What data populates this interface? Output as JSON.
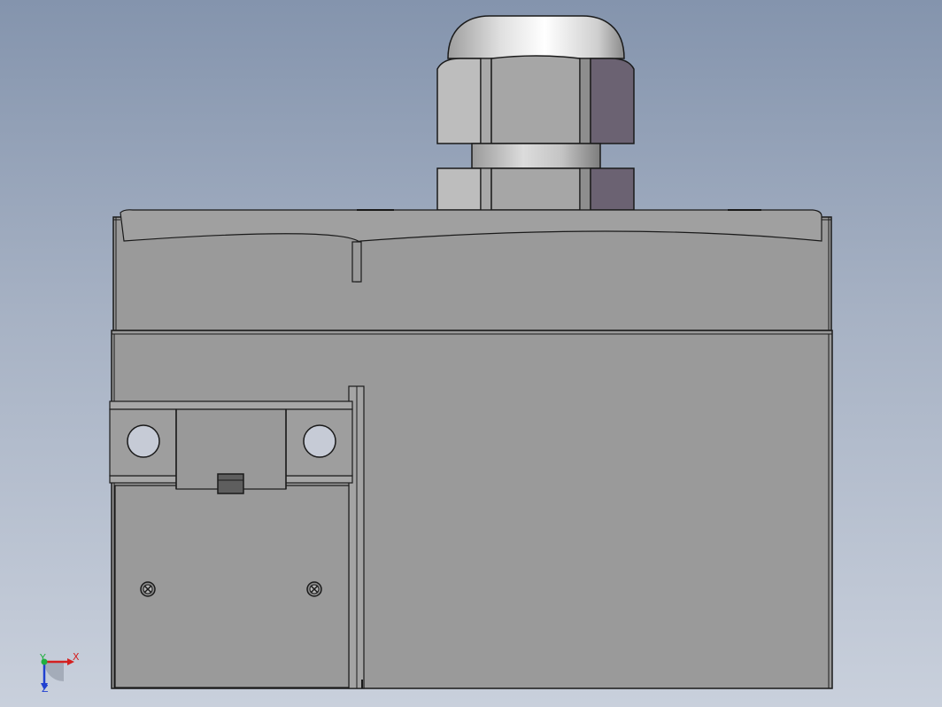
{
  "viewport": {
    "background_top": "#8494ad",
    "background_bottom": "#c9d0dc"
  },
  "model": {
    "body_color": "#9a9a9a",
    "edge_color": "#1a1a1a",
    "nut_face_color": "#b9b9b9",
    "nut_side_color": "#6a6070",
    "dome_color": "#e6e6e6",
    "screw_icon": "cross-screw-icon"
  },
  "triad": {
    "x_label": "X",
    "y_label": "Y",
    "z_label": "Z",
    "x_color": "#d42020",
    "y_color": "#20b040",
    "z_color": "#2040d0"
  }
}
